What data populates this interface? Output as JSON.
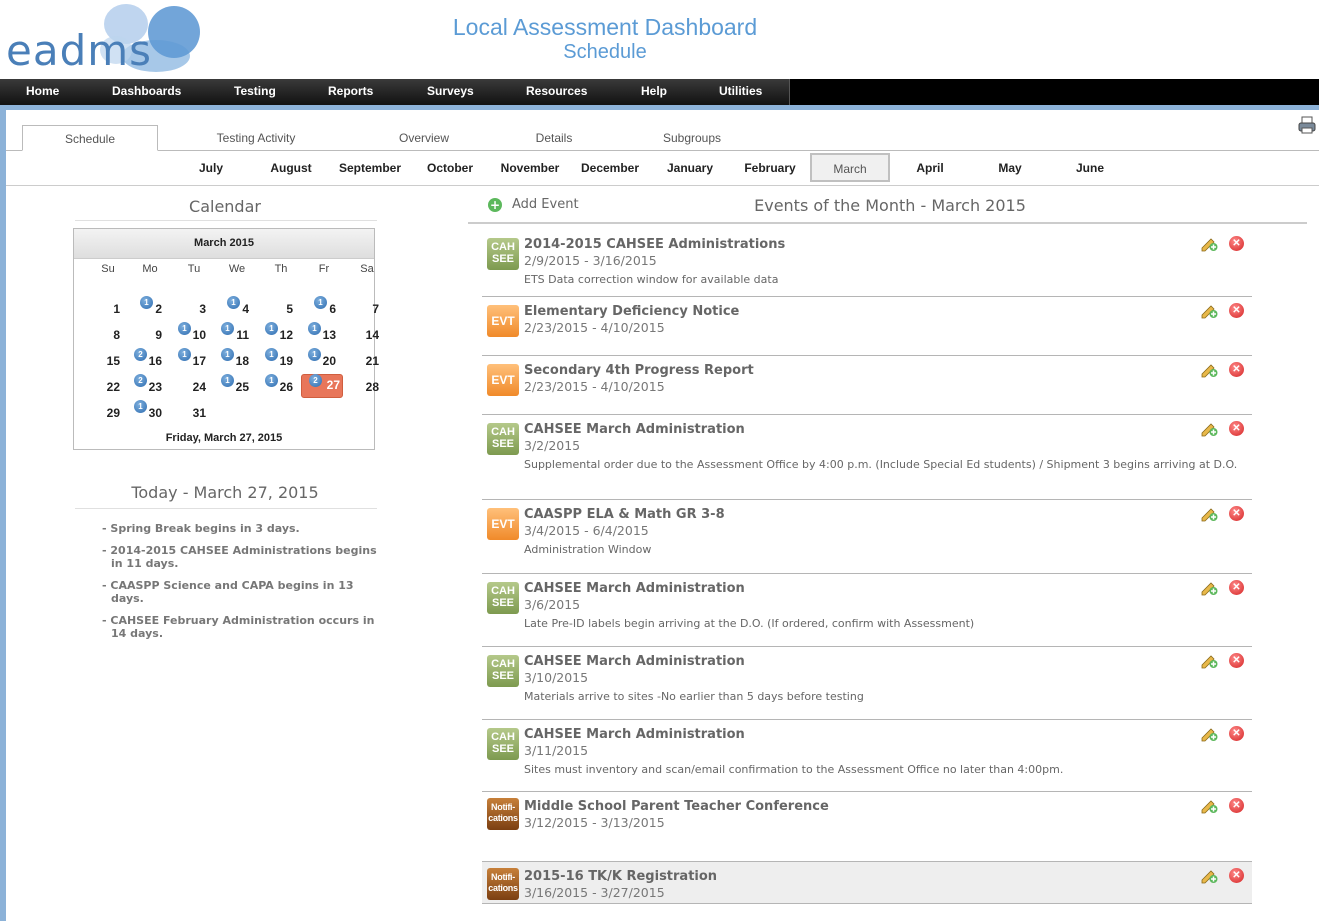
{
  "header": {
    "logo_text": "eadms",
    "title": "Local Assessment Dashboard",
    "subtitle": "Schedule"
  },
  "nav": [
    {
      "label": "Home"
    },
    {
      "label": "Dashboards"
    },
    {
      "label": "Testing"
    },
    {
      "label": "Reports"
    },
    {
      "label": "Surveys"
    },
    {
      "label": "Resources"
    },
    {
      "label": "Help"
    },
    {
      "label": "Utilities"
    }
  ],
  "tabs": [
    {
      "label": "Schedule",
      "active": true
    },
    {
      "label": "Testing Activity"
    },
    {
      "label": "Overview"
    },
    {
      "label": "Details"
    },
    {
      "label": "Subgroups"
    }
  ],
  "months": [
    "July",
    "August",
    "September",
    "October",
    "November",
    "December",
    "January",
    "February",
    "March",
    "April",
    "May",
    "June"
  ],
  "active_month": "March",
  "calendar": {
    "section_title": "Calendar",
    "month_label": "March 2015",
    "dow": [
      "Su",
      "Mo",
      "Tu",
      "We",
      "Th",
      "Fr",
      "Sa"
    ],
    "selected_label": "Friday, March 27, 2015",
    "today_day": 27,
    "badges": {
      "2": 1,
      "4": 1,
      "6": 1,
      "10": 1,
      "11": 1,
      "12": 1,
      "13": 1,
      "16": 2,
      "17": 1,
      "18": 1,
      "19": 1,
      "20": 1,
      "23": 2,
      "25": 1,
      "26": 1,
      "27": 2,
      "30": 1
    }
  },
  "today": {
    "title": "Today - March 27, 2015",
    "items": [
      "- Spring Break begins in 3 days.",
      "- 2014-2015 CAHSEE Administrations begins in 11 days.",
      "- CAASPP Science and CAPA begins in 13 days.",
      "- CAHSEE February Administration occurs in 14 days."
    ]
  },
  "events_section": {
    "add_label": "Add Event",
    "title": "Events of the Month - March 2015"
  },
  "events": [
    {
      "type": "cahsee",
      "title": "2014-2015 CAHSEE Administrations",
      "date": "2/9/2015 - 3/16/2015",
      "desc": "ETS Data correction window for available data"
    },
    {
      "type": "evt",
      "title": "Elementary Deficiency Notice",
      "date": "2/23/2015 - 4/10/2015",
      "desc": ""
    },
    {
      "type": "evt",
      "title": "Secondary 4th Progress Report",
      "date": "2/23/2015 - 4/10/2015",
      "desc": ""
    },
    {
      "type": "cahsee",
      "title": "CAHSEE March Administration",
      "date": "3/2/2015",
      "desc": "Supplemental order due to the Assessment Office by 4:00 p.m. (Include Special Ed students) / Shipment 3 begins arriving at D.O."
    },
    {
      "type": "evt",
      "title": "CAASPP ELA & Math GR 3-8",
      "date": "3/4/2015 - 6/4/2015",
      "desc": "Administration Window"
    },
    {
      "type": "cahsee",
      "title": "CAHSEE March Administration",
      "date": "3/6/2015",
      "desc": "Late Pre-ID labels begin arriving at the D.O. (If ordered, confirm with Assessment)"
    },
    {
      "type": "cahsee",
      "title": "CAHSEE March Administration",
      "date": "3/10/2015",
      "desc": "Materials arrive to sites -No earlier than 5 days before testing"
    },
    {
      "type": "cahsee",
      "title": "CAHSEE March Administration",
      "date": "3/11/2015",
      "desc": "Sites must inventory and scan/email confirmation to the Assessment Office no later than 4:00pm."
    },
    {
      "type": "notif",
      "title": "Middle School Parent Teacher Conference",
      "date": "3/12/2015 - 3/13/2015",
      "desc": ""
    },
    {
      "type": "notif",
      "title": "2015-16 TK/K Registration",
      "date": "3/16/2015 - 3/27/2015",
      "desc": "",
      "highlighted": true
    }
  ],
  "icon_labels": {
    "cahsee": "CAH SEE",
    "evt": "EVT",
    "notif": "Notifi- cations"
  },
  "colors": {
    "title_blue": "#5b9bd5",
    "logo_blue": "#4a7fb8",
    "today_orange": "#e8765a",
    "cahsee_green": "#8aa35b",
    "evt_orange": "#f5a048",
    "notif_brown": "#a35e23"
  }
}
